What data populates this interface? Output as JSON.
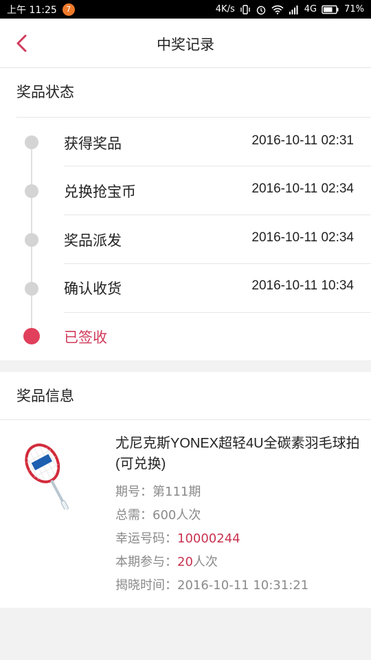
{
  "status_bar": {
    "time": "上午 11:25",
    "app_badge": "7",
    "speed": "4K/s",
    "network": "4G",
    "battery": "71%"
  },
  "header": {
    "title": "中奖记录"
  },
  "prize_status": {
    "title": "奖品状态",
    "steps": [
      {
        "label": "获得奖品",
        "time": "2016-10-11 02:31",
        "active": false
      },
      {
        "label": "兑换抢宝币",
        "time": "2016-10-11 02:34",
        "active": false
      },
      {
        "label": "奖品派发",
        "time": "2016-10-11 02:34",
        "active": false
      },
      {
        "label": "确认收货",
        "time": "2016-10-11 10:34",
        "active": false
      },
      {
        "label": "已签收",
        "time": "",
        "active": true
      }
    ]
  },
  "prize_info": {
    "title": "奖品信息",
    "product_name": "尤尼克斯YONEX超轻4U全碳素羽毛球拍(可兑换)",
    "issue_label": "期号：",
    "issue_value": "第111期",
    "total_label": "总需：",
    "total_value": "600人次",
    "lucky_label": "幸运号码：",
    "lucky_value": "10000244",
    "join_label": "本期参与：",
    "join_count": "20",
    "join_unit": "人次",
    "reveal_label": "揭晓时间：",
    "reveal_value": "2016-10-11 10:31:21"
  },
  "colors": {
    "accent": "#e0405c",
    "accent_text": "#c8324f",
    "inactive_dot": "#d4d4d4"
  }
}
